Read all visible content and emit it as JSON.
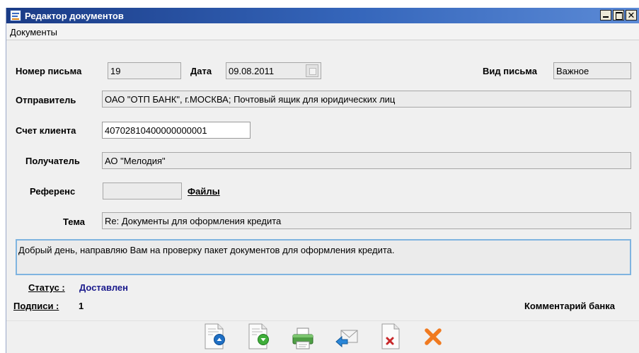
{
  "window": {
    "title": "Редактор документов",
    "controls": {
      "minimize": "_",
      "maximize": "□",
      "close": "×"
    }
  },
  "menu": {
    "items": [
      {
        "label": "Документы"
      }
    ]
  },
  "form": {
    "letter_number": {
      "label": "Номер письма",
      "value": "19"
    },
    "date": {
      "label": "Дата",
      "value": "09.08.2011"
    },
    "letter_type": {
      "label": "Вид письма",
      "value": "Важное"
    },
    "sender": {
      "label": "Отправитель",
      "value": "ОАО \"ОТП БАНК\", г.МОСКВА; Почтовый ящик для юридических лиц"
    },
    "client_account": {
      "label": "Счет клиента",
      "value": "40702810400000000001"
    },
    "recipient": {
      "label": "Получатель",
      "value": "АО \"Мелодия\""
    },
    "reference": {
      "label": "Референс",
      "value": ""
    },
    "files_link": "Файлы",
    "subject": {
      "label": "Тема",
      "value": "Re: Документы для оформления кредита"
    },
    "body": "Добрый день, направляю Вам на проверку пакет документов для оформления кредита."
  },
  "status": {
    "status_label": "Статус :",
    "status_value": "Доставлен",
    "signatures_label": "Подписи :",
    "signatures_value": "1",
    "bank_comment_label": "Комментарий банка"
  },
  "toolbar": {
    "icons": [
      "doc-up-icon",
      "doc-down-icon",
      "print-icon",
      "reply-icon",
      "delete-doc-icon",
      "close-x-icon"
    ],
    "colors": {
      "blue": "#1f6fc4",
      "green": "#3fae3a",
      "red": "#c8282a",
      "orange": "#f07a20"
    }
  }
}
